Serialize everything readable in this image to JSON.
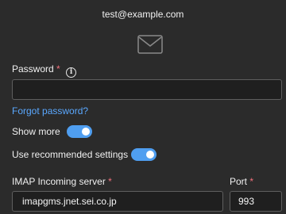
{
  "account": {
    "email": "test@example.com"
  },
  "icons": {
    "envelope": "envelope-icon",
    "info": "info-icon"
  },
  "password": {
    "label": "Password",
    "required_mark": "*",
    "info_glyph": "i",
    "value": ""
  },
  "forgot_password": {
    "text": "Forgot password?"
  },
  "show_more": {
    "label": "Show more",
    "on": true
  },
  "recommended": {
    "label": "Use recommended settings",
    "on": true
  },
  "imap": {
    "label": "IMAP Incoming server",
    "required_mark": "*",
    "value": "imapgms.jnet.sei.co.jp"
  },
  "port": {
    "label": "Port",
    "required_mark": "*",
    "value": "993"
  },
  "colors": {
    "accent": "#4f9ef0",
    "link": "#5aa8ff",
    "required": "#f1707b",
    "background": "#2b2b2b"
  }
}
